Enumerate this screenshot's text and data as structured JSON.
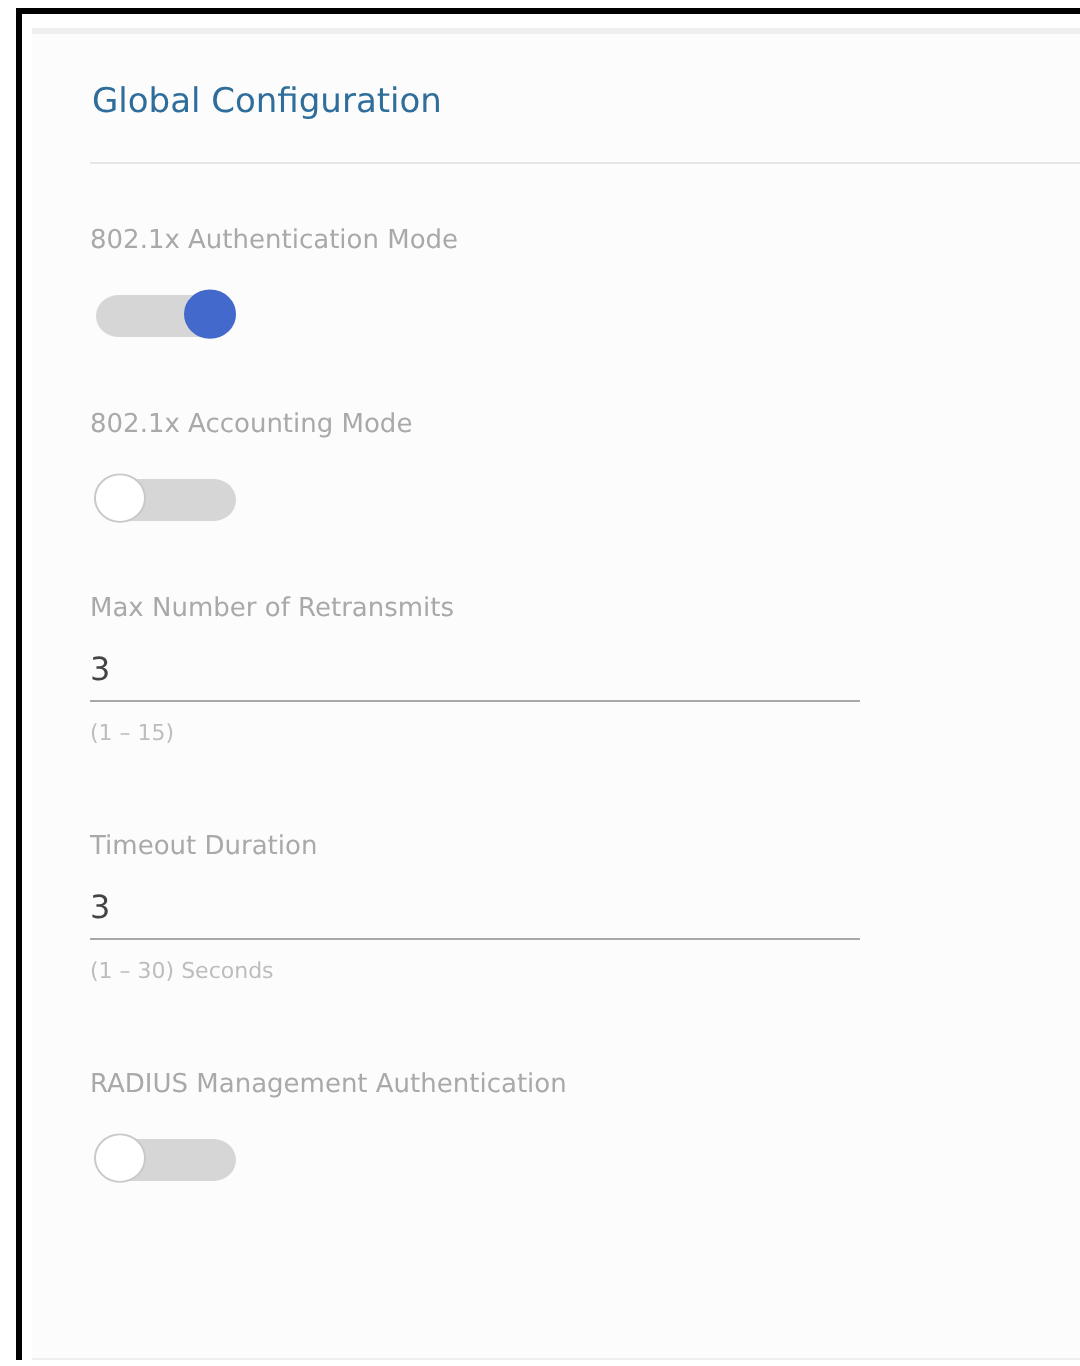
{
  "panel": {
    "title": "Global Configuration",
    "fields": [
      {
        "kind": "toggle",
        "label": "802.1x Authentication Mode",
        "on": true
      },
      {
        "kind": "toggle",
        "label": "802.1x Accounting Mode",
        "on": false
      },
      {
        "kind": "number",
        "label": "Max Number of Retransmits",
        "value": "3",
        "hint": "(1 – 15)"
      },
      {
        "kind": "number",
        "label": "Timeout Duration",
        "value": "3",
        "hint": "(1 – 30) Seconds"
      },
      {
        "kind": "toggle",
        "label": "RADIUS Management Authentication",
        "on": false
      }
    ]
  }
}
